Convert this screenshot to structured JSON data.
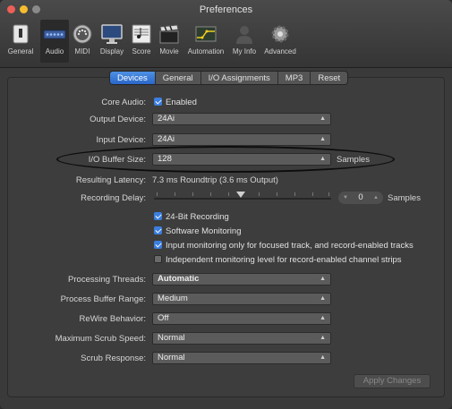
{
  "window": {
    "title": "Preferences",
    "traffic_colors": [
      "#ee5f57",
      "#f5bd2f",
      "#8a8a8a"
    ]
  },
  "toolbar": {
    "items": [
      {
        "label": "General",
        "icon": "switch-icon"
      },
      {
        "label": "Audio",
        "icon": "audio-interface-icon"
      },
      {
        "label": "MIDI",
        "icon": "midi-port-icon"
      },
      {
        "label": "Display",
        "icon": "monitor-icon"
      },
      {
        "label": "Score",
        "icon": "score-icon"
      },
      {
        "label": "Movie",
        "icon": "clapperboard-icon"
      },
      {
        "label": "Automation",
        "icon": "automation-icon"
      },
      {
        "label": "My Info",
        "icon": "person-icon"
      },
      {
        "label": "Advanced",
        "icon": "gear-icon"
      }
    ],
    "selected": "Audio"
  },
  "tabs": [
    "Devices",
    "General",
    "I/O Assignments",
    "MP3",
    "Reset"
  ],
  "active_tab": "Devices",
  "devices": {
    "core_audio_label": "Core Audio:",
    "core_audio_value": "Enabled",
    "output_label": "Output Device:",
    "output_value": "24Ai",
    "input_label": "Input Device:",
    "input_value": "24Ai",
    "buffer_label": "I/O Buffer Size:",
    "buffer_value": "128",
    "buffer_unit": "Samples",
    "latency_label": "Resulting Latency:",
    "latency_value": "7.3 ms Roundtrip (3.6 ms Output)",
    "recording_delay_label": "Recording Delay:",
    "recording_delay_value": "0",
    "recording_delay_unit": "Samples",
    "checkboxes": [
      {
        "label": "24-Bit Recording",
        "checked": true
      },
      {
        "label": "Software Monitoring",
        "checked": true
      },
      {
        "label": "Input monitoring only for focused track, and record-enabled tracks",
        "checked": true
      },
      {
        "label": "Independent monitoring level for record-enabled channel strips",
        "checked": false
      }
    ],
    "threads_label": "Processing Threads:",
    "threads_value": "Automatic",
    "range_label": "Process Buffer Range:",
    "range_value": "Medium",
    "rewire_label": "ReWire Behavior:",
    "rewire_value": "Off",
    "scrub_speed_label": "Maximum Scrub Speed:",
    "scrub_speed_value": "Normal",
    "scrub_response_label": "Scrub Response:",
    "scrub_response_value": "Normal"
  },
  "apply_label": "Apply Changes",
  "colors": {
    "accent": "#2f6fd6",
    "checkbox": "#3b7ee0"
  }
}
